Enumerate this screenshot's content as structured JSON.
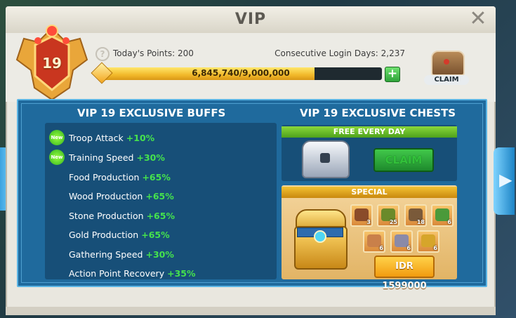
{
  "window": {
    "title": "VIP",
    "close_icon": "close-icon"
  },
  "vip": {
    "level": "19",
    "todays_points": "Today's Points: 200",
    "consecutive_login": "Consecutive Login Days: 2,237",
    "progress_text": "6,845,740/9,000,000",
    "progress_fraction": 0.7606,
    "plus_icon": "plus-icon",
    "claim_label": "CLAIM",
    "help_icon": "help-icon"
  },
  "buffs": {
    "title": "VIP 19 EXCLUSIVE BUFFS",
    "new_label": "New",
    "items": [
      {
        "name": "Troop Attack",
        "value": "+10%",
        "is_new": true
      },
      {
        "name": "Training Speed",
        "value": "+30%",
        "is_new": true
      },
      {
        "name": "Food Production",
        "value": "+65%",
        "is_new": false
      },
      {
        "name": "Wood Production",
        "value": "+65%",
        "is_new": false
      },
      {
        "name": "Stone Production",
        "value": "+65%",
        "is_new": false
      },
      {
        "name": "Gold Production",
        "value": "+65%",
        "is_new": false
      },
      {
        "name": "Gathering Speed",
        "value": "+30%",
        "is_new": false
      },
      {
        "name": "Action Point Recovery",
        "value": "+35%",
        "is_new": false
      }
    ]
  },
  "chests": {
    "title": "VIP 19 EXCLUSIVE CHESTS",
    "free": {
      "ribbon": "FREE EVERY DAY",
      "claim_label": "CLAIM"
    },
    "special": {
      "ribbon": "SPECIAL",
      "price": "IDR 1599000",
      "items": [
        {
          "icon": "chest-item-icon",
          "qty": "3",
          "color": "#8a4b2a"
        },
        {
          "icon": "speedup-item-icon",
          "qty": "25",
          "color": "#6a8a2a"
        },
        {
          "icon": "pickaxe-item-icon",
          "qty": "18",
          "color": "#7a5a3a"
        },
        {
          "icon": "resource-pack-icon",
          "qty": "6",
          "color": "#4a9a3a"
        },
        {
          "icon": "food-pack-icon",
          "qty": "6",
          "color": "#c9804a"
        },
        {
          "icon": "stone-pack-icon",
          "qty": "6",
          "color": "#8a8aa8"
        },
        {
          "icon": "gold-pack-icon",
          "qty": "6",
          "color": "#d6a52a"
        }
      ]
    }
  },
  "colors": {
    "buff_value": "#45e24d",
    "frame_blue": "#1f6a9d",
    "accent_gold": "#f2b92a"
  }
}
